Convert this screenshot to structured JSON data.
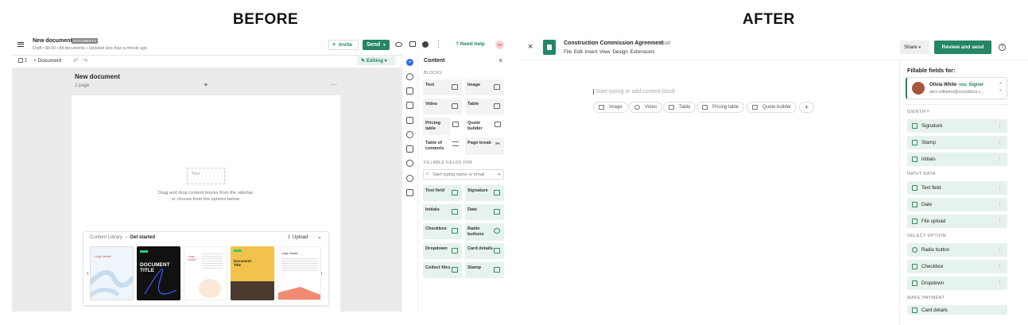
{
  "headings": {
    "before": "BEFORE",
    "after": "AFTER"
  },
  "before": {
    "doc_title": "New document",
    "doc_badge": "DOCUMENTS",
    "doc_meta": "Draft • $0.00 • All documents • Updated less than a minute ago",
    "invite": "Invite",
    "send": "Send",
    "need_help": "Need help",
    "avatar": "SE",
    "page_count": "1",
    "add_document": "Document",
    "editing": "Editing",
    "canvas_title": "New document",
    "canvas_sub": "1 page",
    "text_placeholder": "Text",
    "drop_hint_1": "Drag and drop content blocks from the sidebar,",
    "drop_hint_2": "or choose from the options below.",
    "library": {
      "crumb": "Content Library",
      "current": "Get started",
      "upload": "Upload",
      "tile_texts": [
        "Large header",
        "DOCUMENT TITLE",
        "Large header",
        "Document Title",
        "Large header"
      ]
    },
    "content_panel": {
      "title": "Content",
      "blocks_label": "BLOCKS",
      "blocks": [
        "Text",
        "Image",
        "Video",
        "Table",
        "Pricing table",
        "Quote builder",
        "Table of contents",
        "Page break"
      ],
      "fillable_label": "FILLABLE FIELDS FOR",
      "search_placeholder": "Start typing name or email",
      "fields": [
        "Text field",
        "Signature",
        "Initials",
        "Date",
        "Checkbox",
        "Radio buttons",
        "Dropdown",
        "Card details",
        "Collect files",
        "Stamp"
      ]
    }
  },
  "after": {
    "doc_title": "Construction Commission Agreement",
    "status": "Draft",
    "menu": [
      "File",
      "Edit",
      "Insert",
      "View",
      "Design",
      "Extensions"
    ],
    "share": "Share",
    "review_send": "Review and send",
    "editor_placeholder": "Start typing or add content block",
    "chips": [
      "Image",
      "Video",
      "Table",
      "Pricing table",
      "Quote builder"
    ],
    "fillable_for": "Fillable fields for:",
    "signer": {
      "name": "Olivia White",
      "you": "YOU",
      "role": "Signer",
      "email": "alex.williams@xxxxldocs.c..."
    },
    "sections": {
      "identify": {
        "label": "IDENTIFY",
        "items": [
          "Signature",
          "Stamp",
          "Initials"
        ]
      },
      "input": {
        "label": "INPUT DATA",
        "items": [
          "Text field",
          "Date",
          "File upload"
        ]
      },
      "select": {
        "label": "SELECT OPTION",
        "items": [
          "Radio button",
          "Checkbox",
          "Dropdown"
        ]
      },
      "payment": {
        "label": "MAKE PAYMENT",
        "items": [
          "Card details"
        ]
      }
    }
  },
  "colors": {
    "accent": "#248567",
    "panel_bg": "#e6f2ec",
    "canvas_bg": "#ebebeb"
  }
}
